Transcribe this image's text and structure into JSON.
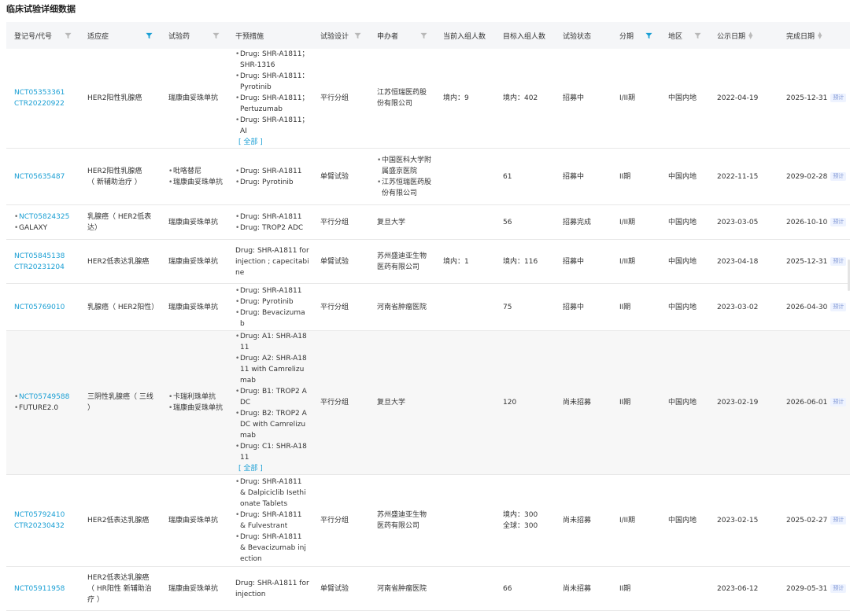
{
  "page": {
    "title": "临床试验详细数据"
  },
  "colors": {
    "link": "#1a9fd4",
    "filter_active": "#1a9fd4",
    "filter_inactive": "#b8b8b8",
    "header_bg": "#f5f6f8",
    "tag_bg": "#eef3ff"
  },
  "columns": [
    {
      "label": "登记号/代号",
      "filter": "inactive"
    },
    {
      "label": "适应症",
      "filter": "active"
    },
    {
      "label": "试验药",
      "filter": "inactive"
    },
    {
      "label": "干预措施",
      "filter": "none"
    },
    {
      "label": "试验设计",
      "filter": "inactive"
    },
    {
      "label": "申办者",
      "filter": "inactive"
    },
    {
      "label": "当前入组人数",
      "filter": "none"
    },
    {
      "label": "目标入组人数",
      "filter": "none"
    },
    {
      "label": "试验状态",
      "filter": "none"
    },
    {
      "label": "分期",
      "filter": "active"
    },
    {
      "label": "地区",
      "filter": "inactive"
    },
    {
      "label": "公示日期",
      "filter": "sort"
    },
    {
      "label": "完成日期",
      "filter": "sort"
    }
  ],
  "expand_label": "[ 全部 ]",
  "predict_label": "预计",
  "rows": [
    {
      "ids": [
        "NCT05353361",
        "CTR20220922"
      ],
      "ids_style": "links",
      "indication": [
        "HER2阳性乳腺癌"
      ],
      "drugs": [
        "瑞康曲妥珠单抗"
      ],
      "drugs_bulleted": false,
      "interventions": [
        "Drug: SHR-A1811；SHR-1316",
        "Drug: SHR-A1811：Pyrotinib",
        "Drug: SHR-A1811；Pertuzumab",
        "Drug: SHR-A1811；AI"
      ],
      "interventions_bulleted": true,
      "expand": true,
      "design": "平行分组",
      "sponsors": [
        "江苏恒瑞医药股份有限公司"
      ],
      "sponsors_bulleted": false,
      "current": "境内：9",
      "target": [
        "境内：402"
      ],
      "status": "招募中",
      "phase": "I/II期",
      "region": "中国内地",
      "pub_date": "2022-04-19",
      "end_date": "2025-12-31",
      "shaded": false
    },
    {
      "ids": [
        "NCT05635487"
      ],
      "ids_style": "links",
      "indication": [
        "HER2阳性乳腺癌",
        "（ 新辅助治疗 ）"
      ],
      "drugs": [
        "吡咯替尼",
        "瑞康曲妥珠单抗"
      ],
      "drugs_bulleted": true,
      "interventions": [
        "Drug: SHR-A1811",
        "Drug: Pyrotinib"
      ],
      "interventions_bulleted": true,
      "expand": false,
      "design": "单臂试验",
      "sponsors": [
        "中国医科大学附属盛京医院",
        "江苏恒瑞医药股份有限公司"
      ],
      "sponsors_bulleted": true,
      "current": "",
      "target": [
        "61"
      ],
      "status": "招募中",
      "phase": "II期",
      "region": "中国内地",
      "pub_date": "2022-11-15",
      "end_date": "2029-02-28",
      "shaded": false
    },
    {
      "ids": [
        "NCT05824325",
        "GALAXY"
      ],
      "ids_style": "bullets",
      "indication": [
        "乳腺癌（ HER2低表达）"
      ],
      "drugs": [
        "瑞康曲妥珠单抗"
      ],
      "drugs_bulleted": false,
      "interventions": [
        "Drug: SHR-A1811",
        "Drug: TROP2 ADC"
      ],
      "interventions_bulleted": true,
      "expand": false,
      "design": "平行分组",
      "sponsors": [
        "复旦大学"
      ],
      "sponsors_bulleted": false,
      "current": "",
      "target": [
        "56"
      ],
      "status": "招募完成",
      "phase": "I/II期",
      "region": "中国内地",
      "pub_date": "2023-03-05",
      "end_date": "2026-10-10",
      "shaded": false
    },
    {
      "ids": [
        "NCT05845138",
        "CTR20231204"
      ],
      "ids_style": "links",
      "indication": [
        "HER2低表达乳腺癌"
      ],
      "drugs": [
        "瑞康曲妥珠单抗"
      ],
      "drugs_bulleted": false,
      "interventions": [
        "Drug: SHR-A1811 for injection ; capecitabine"
      ],
      "interventions_bulleted": false,
      "expand": false,
      "design": "单臂试验",
      "sponsors": [
        "苏州盛迪亚生物医药有限公司"
      ],
      "sponsors_bulleted": false,
      "current": "境内：1",
      "target": [
        "境内：116"
      ],
      "status": "招募中",
      "phase": "I/II期",
      "region": "中国内地",
      "pub_date": "2023-04-18",
      "end_date": "2025-12-31",
      "shaded": false
    },
    {
      "ids": [
        "NCT05769010"
      ],
      "ids_style": "links",
      "indication": [
        "乳腺癌（ HER2阳性）"
      ],
      "drugs": [
        "瑞康曲妥珠单抗"
      ],
      "drugs_bulleted": false,
      "interventions": [
        "Drug: SHR-A1811",
        "Drug: Pyrotinib",
        "Drug: Bevacizumab"
      ],
      "interventions_bulleted": true,
      "expand": false,
      "design": "平行分组",
      "sponsors": [
        "河南省肿瘤医院"
      ],
      "sponsors_bulleted": false,
      "current": "",
      "target": [
        "75"
      ],
      "status": "招募中",
      "phase": "II期",
      "region": "中国内地",
      "pub_date": "2023-03-02",
      "end_date": "2026-04-30",
      "shaded": false
    },
    {
      "ids": [
        "NCT05749588",
        "FUTURE2.0"
      ],
      "ids_style": "bullets",
      "indication": [
        "三阴性乳腺癌（ 三线 ）"
      ],
      "drugs": [
        "卡瑞利珠单抗",
        "瑞康曲妥珠单抗"
      ],
      "drugs_bulleted": true,
      "interventions": [
        "Drug: A1: SHR-A1811",
        "Drug: A2: SHR-A1811 with Camrelizumab",
        "Drug: B1: TROP2 ADC",
        "Drug: B2: TROP2 ADC with Camrelizumab",
        "Drug: C1: SHR-A1811"
      ],
      "interventions_bulleted": true,
      "expand": true,
      "design": "平行分组",
      "sponsors": [
        "复旦大学"
      ],
      "sponsors_bulleted": false,
      "current": "",
      "target": [
        "120"
      ],
      "status": "尚未招募",
      "phase": "II期",
      "region": "中国内地",
      "pub_date": "2023-02-19",
      "end_date": "2026-06-01",
      "shaded": true
    },
    {
      "ids": [
        "NCT05792410",
        "CTR20230432"
      ],
      "ids_style": "links",
      "indication": [
        "HER2低表达乳腺癌"
      ],
      "drugs": [
        "瑞康曲妥珠单抗"
      ],
      "drugs_bulleted": false,
      "interventions": [
        "Drug: SHR-A1811 & Dalpiciclib Isethionate Tablets",
        "Drug: SHR-A1811 & Fulvestrant",
        "Drug: SHR-A1811 & Bevacizumab injection"
      ],
      "interventions_bulleted": true,
      "expand": false,
      "design": "平行分组",
      "sponsors": [
        "苏州盛迪亚生物医药有限公司"
      ],
      "sponsors_bulleted": false,
      "current": "",
      "target": [
        "境内：300",
        "全球：300"
      ],
      "status": "尚未招募",
      "phase": "I/II期",
      "region": "中国内地",
      "pub_date": "2023-02-15",
      "end_date": "2025-02-27",
      "shaded": false
    },
    {
      "ids": [
        "NCT05911958"
      ],
      "ids_style": "links",
      "indication": [
        "HER2低表达乳腺癌",
        "（ HR阳性 新辅助治疗 ）"
      ],
      "drugs": [
        "瑞康曲妥珠单抗"
      ],
      "drugs_bulleted": false,
      "interventions": [
        "Drug: SHR-A1811 for injection"
      ],
      "interventions_bulleted": false,
      "expand": false,
      "design": "单臂试验",
      "sponsors": [
        "河南省肿瘤医院"
      ],
      "sponsors_bulleted": false,
      "current": "",
      "target": [
        "66"
      ],
      "status": "尚未招募",
      "phase": "II期",
      "region": "",
      "pub_date": "2023-06-12",
      "end_date": "2029-05-31",
      "shaded": false
    }
  ]
}
